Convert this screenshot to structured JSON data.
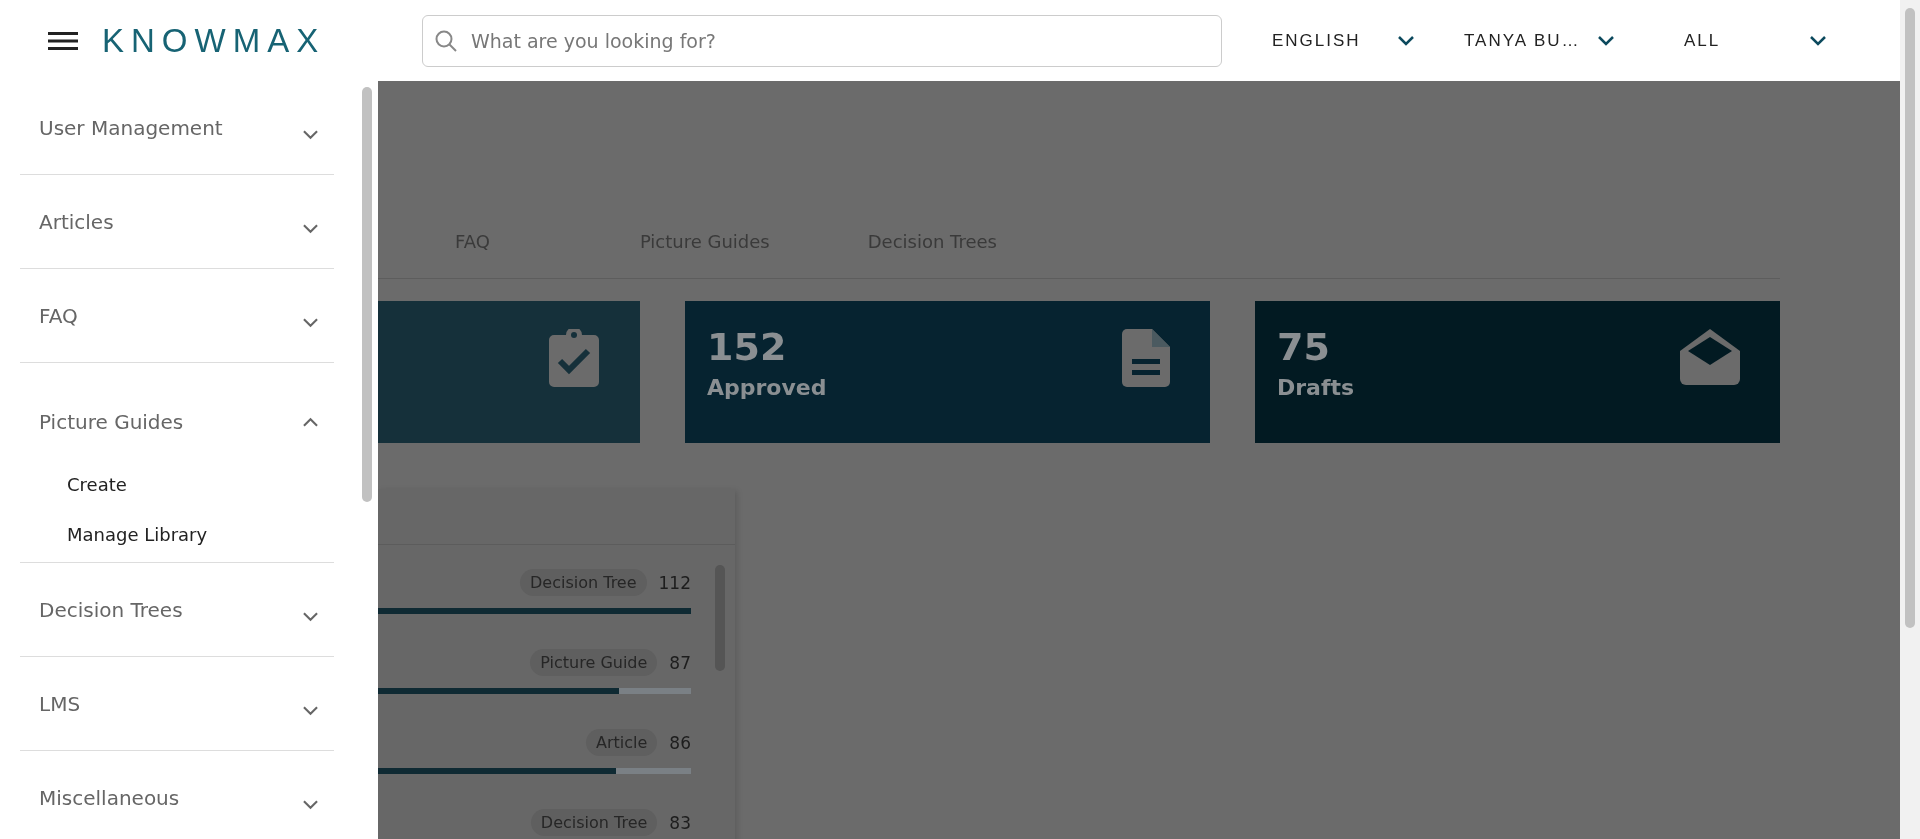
{
  "header": {
    "brand": "KNOWMAX",
    "search": {
      "placeholder": "What are you looking for?"
    },
    "dropdowns": [
      {
        "label": "ENGLISH"
      },
      {
        "label": "TANYA BU…"
      },
      {
        "label": "ALL"
      }
    ]
  },
  "sidebar": {
    "items": [
      {
        "label": "User Management",
        "expanded": false
      },
      {
        "label": "Articles",
        "expanded": false
      },
      {
        "label": "FAQ",
        "expanded": false
      },
      {
        "label": "Picture Guides",
        "expanded": true,
        "children": [
          {
            "label": "Create"
          },
          {
            "label": "Manage Library"
          }
        ]
      },
      {
        "label": "Decision Trees",
        "expanded": false
      },
      {
        "label": "LMS",
        "expanded": false
      },
      {
        "label": "Miscellaneous",
        "expanded": false
      }
    ]
  },
  "tabs": [
    {
      "label": "FAQ",
      "selected": false
    },
    {
      "label": "Picture Guides",
      "selected": false
    },
    {
      "label": "Decision Trees",
      "selected": false
    }
  ],
  "stat_cards": [
    {
      "kind": "clipboard",
      "color": "#15303a"
    },
    {
      "kind": "document",
      "color": "#062330",
      "value": "152",
      "label": "Approved"
    },
    {
      "kind": "envelope",
      "color": "#021a22",
      "value": "75",
      "label": "Drafts"
    }
  ],
  "panel": {
    "rows": [
      {
        "tag": "Decision Tree",
        "count": "112",
        "level": 1
      },
      {
        "tag": "Picture Guide",
        "count": "87",
        "level": 0.77
      },
      {
        "tag": "Article",
        "count": "86",
        "level": 0.76
      },
      {
        "tag": "Decision Tree",
        "count": "83"
      }
    ]
  }
}
